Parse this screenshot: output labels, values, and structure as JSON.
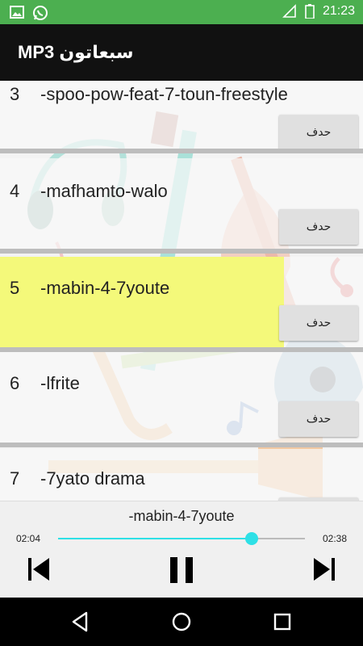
{
  "status_bar": {
    "time": "21:23",
    "icons": [
      "image-icon",
      "whatsapp-icon",
      "signal-icon",
      "battery-icon"
    ]
  },
  "app_bar": {
    "title": "سبعاتون MP3"
  },
  "list": {
    "delete_label": "حدف",
    "items": [
      {
        "number": "3",
        "name": "-spoo-pow-feat-7-toun-freestyle",
        "highlighted": false
      },
      {
        "number": "4",
        "name": "-mafhamto-walo",
        "highlighted": false
      },
      {
        "number": "5",
        "name": "-mabin-4-7youte",
        "highlighted": true
      },
      {
        "number": "6",
        "name": "-lfrite",
        "highlighted": false
      },
      {
        "number": "7",
        "name": "-7yato drama",
        "highlighted": false
      }
    ]
  },
  "player": {
    "track": "-mabin-4-7youte",
    "elapsed": "02:04",
    "duration": "02:38",
    "progress": 0.785
  },
  "colors": {
    "status_bar": "#4caf50",
    "app_bar": "#111111",
    "highlight": "#f4f97a",
    "seek": "#2ee0e6"
  }
}
